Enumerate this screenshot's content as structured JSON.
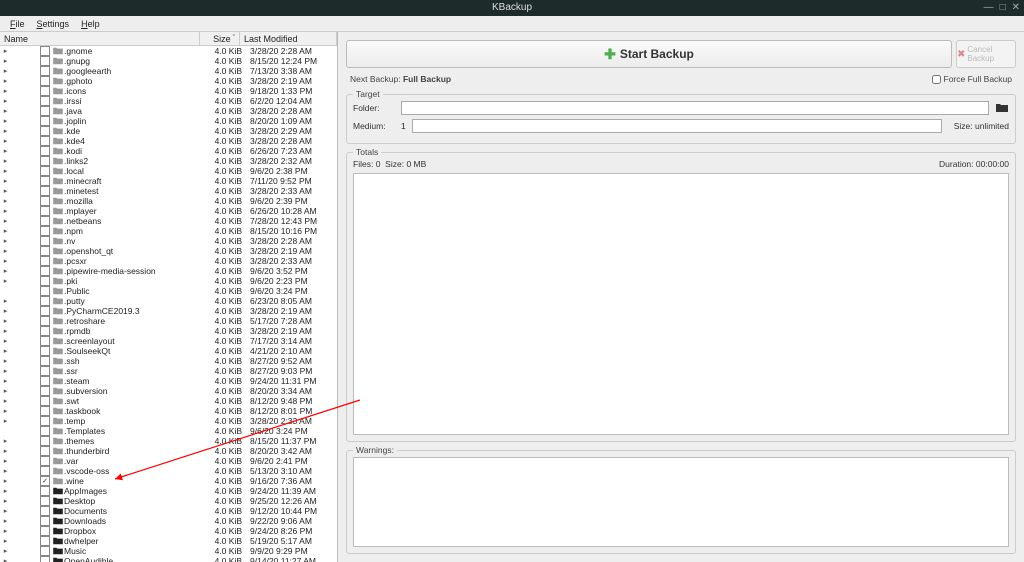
{
  "window": {
    "title": "KBackup"
  },
  "menubar": {
    "file": "File",
    "settings": "Settings",
    "help": "Help"
  },
  "tree": {
    "headers": {
      "name": "Name",
      "size": "Size",
      "modified": "Last Modified"
    },
    "items": [
      {
        "name": ".gnome",
        "size": "4.0 KiB",
        "mod": "3/28/20 2:28 AM",
        "exp": true
      },
      {
        "name": ".gnupg",
        "size": "4.0 KiB",
        "mod": "8/15/20 12:24 PM",
        "exp": true
      },
      {
        "name": ".googleearth",
        "size": "4.0 KiB",
        "mod": "7/13/20 3:38 AM",
        "exp": true
      },
      {
        "name": ".gphoto",
        "size": "4.0 KiB",
        "mod": "3/28/20 2:19 AM",
        "exp": true
      },
      {
        "name": ".icons",
        "size": "4.0 KiB",
        "mod": "9/18/20 1:33 PM",
        "exp": true
      },
      {
        "name": ".irssi",
        "size": "4.0 KiB",
        "mod": "6/2/20 12:04 AM",
        "exp": true
      },
      {
        "name": ".java",
        "size": "4.0 KiB",
        "mod": "3/28/20 2:28 AM",
        "exp": true
      },
      {
        "name": ".joplin",
        "size": "4.0 KiB",
        "mod": "8/20/20 1:09 AM",
        "exp": true
      },
      {
        "name": ".kde",
        "size": "4.0 KiB",
        "mod": "3/28/20 2:29 AM",
        "exp": true
      },
      {
        "name": ".kde4",
        "size": "4.0 KiB",
        "mod": "3/28/20 2:28 AM",
        "exp": true
      },
      {
        "name": ".kodi",
        "size": "4.0 KiB",
        "mod": "6/26/20 7:23 AM",
        "exp": true
      },
      {
        "name": ".links2",
        "size": "4.0 KiB",
        "mod": "3/28/20 2:32 AM",
        "exp": true
      },
      {
        "name": ".local",
        "size": "4.0 KiB",
        "mod": "9/6/20 2:38 PM",
        "exp": true
      },
      {
        "name": ".minecraft",
        "size": "4.0 KiB",
        "mod": "7/11/20 9:52 PM",
        "exp": true
      },
      {
        "name": ".minetest",
        "size": "4.0 KiB",
        "mod": "3/28/20 2:33 AM",
        "exp": true
      },
      {
        "name": ".mozilla",
        "size": "4.0 KiB",
        "mod": "9/6/20 2:39 PM",
        "exp": true
      },
      {
        "name": ".mplayer",
        "size": "4.0 KiB",
        "mod": "6/26/20 10:28 AM",
        "exp": true
      },
      {
        "name": ".netbeans",
        "size": "4.0 KiB",
        "mod": "7/28/20 12:43 PM",
        "exp": true
      },
      {
        "name": ".npm",
        "size": "4.0 KiB",
        "mod": "8/15/20 10:16 PM",
        "exp": true
      },
      {
        "name": ".nv",
        "size": "4.0 KiB",
        "mod": "3/28/20 2:28 AM",
        "exp": true
      },
      {
        "name": ".openshot_qt",
        "size": "4.0 KiB",
        "mod": "3/28/20 2:19 AM",
        "exp": true
      },
      {
        "name": ".pcsxr",
        "size": "4.0 KiB",
        "mod": "3/28/20 2:33 AM",
        "exp": true
      },
      {
        "name": ".pipewire-media-session",
        "size": "4.0 KiB",
        "mod": "9/6/20 3:52 PM",
        "exp": true
      },
      {
        "name": ".pki",
        "size": "4.0 KiB",
        "mod": "9/6/20 2:23 PM",
        "exp": true
      },
      {
        "name": ".Public",
        "size": "4.0 KiB",
        "mod": "9/6/20 3:24 PM",
        "exp": false
      },
      {
        "name": ".putty",
        "size": "4.0 KiB",
        "mod": "6/23/20 8:05 AM",
        "exp": true
      },
      {
        "name": ".PyCharmCE2019.3",
        "size": "4.0 KiB",
        "mod": "3/28/20 2:19 AM",
        "exp": true
      },
      {
        "name": ".retroshare",
        "size": "4.0 KiB",
        "mod": "5/17/20 7:28 AM",
        "exp": true
      },
      {
        "name": ".rpmdb",
        "size": "4.0 KiB",
        "mod": "3/28/20 2:19 AM",
        "exp": true
      },
      {
        "name": ".screenlayout",
        "size": "4.0 KiB",
        "mod": "7/17/20 3:14 AM",
        "exp": true
      },
      {
        "name": ".SoulseekQt",
        "size": "4.0 KiB",
        "mod": "4/21/20 2:10 AM",
        "exp": true
      },
      {
        "name": ".ssh",
        "size": "4.0 KiB",
        "mod": "8/27/20 9:52 AM",
        "exp": true
      },
      {
        "name": ".ssr",
        "size": "4.0 KiB",
        "mod": "8/27/20 9:03 PM",
        "exp": true
      },
      {
        "name": ".steam",
        "size": "4.0 KiB",
        "mod": "9/24/20 11:31 PM",
        "exp": true
      },
      {
        "name": ".subversion",
        "size": "4.0 KiB",
        "mod": "8/20/20 3:34 AM",
        "exp": true
      },
      {
        "name": ".swt",
        "size": "4.0 KiB",
        "mod": "8/12/20 9:48 PM",
        "exp": true
      },
      {
        "name": ".taskbook",
        "size": "4.0 KiB",
        "mod": "8/12/20 8:01 PM",
        "exp": true
      },
      {
        "name": ".temp",
        "size": "4.0 KiB",
        "mod": "3/28/20 2:33 AM",
        "exp": true
      },
      {
        "name": ".Templates",
        "size": "4.0 KiB",
        "mod": "9/6/20 3:24 PM",
        "exp": false
      },
      {
        "name": ".themes",
        "size": "4.0 KiB",
        "mod": "8/15/20 11:37 PM",
        "exp": true
      },
      {
        "name": ".thunderbird",
        "size": "4.0 KiB",
        "mod": "8/20/20 3:42 AM",
        "exp": true
      },
      {
        "name": ".var",
        "size": "4.0 KiB",
        "mod": "9/6/20 2:41 PM",
        "exp": true
      },
      {
        "name": ".vscode-oss",
        "size": "4.0 KiB",
        "mod": "5/13/20 3:10 AM",
        "exp": true
      },
      {
        "name": ".wine",
        "size": "4.0 KiB",
        "mod": "9/16/20 7:36 AM",
        "exp": true,
        "checked": true
      },
      {
        "name": "AppImages",
        "size": "4.0 KiB",
        "mod": "9/24/20 11:39 AM",
        "exp": true,
        "dark": true
      },
      {
        "name": "Desktop",
        "size": "4.0 KiB",
        "mod": "9/25/20 12:26 AM",
        "exp": true,
        "dark": true
      },
      {
        "name": "Documents",
        "size": "4.0 KiB",
        "mod": "9/12/20 10:44 PM",
        "exp": true,
        "dark": true
      },
      {
        "name": "Downloads",
        "size": "4.0 KiB",
        "mod": "9/22/20 9:06 AM",
        "exp": true,
        "dark": true
      },
      {
        "name": "Dropbox",
        "size": "4.0 KiB",
        "mod": "9/24/20 8:26 PM",
        "exp": true,
        "dark": true
      },
      {
        "name": "dwhelper",
        "size": "4.0 KiB",
        "mod": "5/19/20 5:17 AM",
        "exp": true,
        "dark": true
      },
      {
        "name": "Music",
        "size": "4.0 KiB",
        "mod": "9/9/20 9:29 PM",
        "exp": true,
        "dark": true
      },
      {
        "name": "OpenAudible",
        "size": "4.0 KiB",
        "mod": "9/14/20 11:27 AM",
        "exp": true,
        "dark": true
      }
    ]
  },
  "right": {
    "start_label": "Start Backup",
    "cancel_label": "Cancel Backup",
    "next_backup_label": "Next Backup:",
    "next_backup_value": "Full Backup",
    "force_full_label": "Force Full Backup",
    "target_title": "Target",
    "folder_label": "Folder:",
    "medium_label": "Medium:",
    "medium_value": "1",
    "size_label": "Size:",
    "size_value": "unlimited",
    "totals_title": "Totals",
    "files_label": "Files:",
    "files_value": "0",
    "totsize_label": "Size:",
    "totsize_value": "0 MB",
    "duration_label": "Duration:",
    "duration_value": "00:00:00",
    "warnings_title": "Warnings:"
  }
}
